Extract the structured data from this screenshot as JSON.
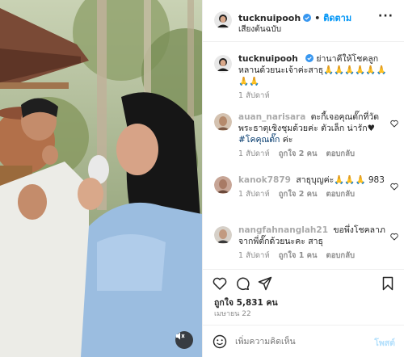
{
  "header": {
    "username": "tucknuipooh",
    "follow_label": "ติดตาม",
    "subtitle": "เสียงต้นฉบับ",
    "more_label": "···"
  },
  "caption": {
    "username": "tucknuipooh",
    "text": "ย่านาคีให้โชคลูกหลานด้วยนะเจ้าค่ะสาธุ🙏🙏🙏🙏🙏🙏🙏🙏",
    "time": "1 สัปดาห์"
  },
  "comments": [
    {
      "username": "auan_narisara",
      "text": "ตะกี้เจอคุณตั๊กที่วัดพระธาตุเชิงชุมด้วยค่ะ ตัวเล็ก น่ารัก♥",
      "hashtag": "#โคคุณตั๊ก",
      "suffix": "ค่ะ",
      "time": "1 สัปดาห์",
      "likes": "ถูกใจ 2 คน",
      "reply": "ตอบกลับ"
    },
    {
      "username": "kanok7879",
      "text": "สาธุบุญค่ะ🙏🙏🙏 983",
      "time": "1 สัปดาห์",
      "likes": "ถูกใจ 2 คน",
      "reply": "ตอบกลับ"
    },
    {
      "username": "nangfahnanglah21",
      "text": "ขอพึ่งโชคลาภจากพี่ตั๊กด้วยนะคะ สาธุ",
      "time": "1 สัปดาห์",
      "likes": "ถูกใจ 1 คน",
      "reply": "ตอบกลับ"
    }
  ],
  "stats": {
    "likes": "ถูกใจ 5,831 คน",
    "date": "เมษายน 22"
  },
  "add_comment": {
    "placeholder": "เพิ่มความคิดเห็น",
    "post_label": "โพสต์"
  },
  "colors": {
    "accent": "#0095f6",
    "verified": "#3897f0",
    "text": "#262626",
    "muted": "#8e8e8e"
  },
  "icons": [
    "verified-badge-icon",
    "more-options-icon",
    "heart-icon",
    "comment-icon",
    "share-icon",
    "bookmark-icon",
    "emoji-icon",
    "muted-speaker-icon"
  ]
}
